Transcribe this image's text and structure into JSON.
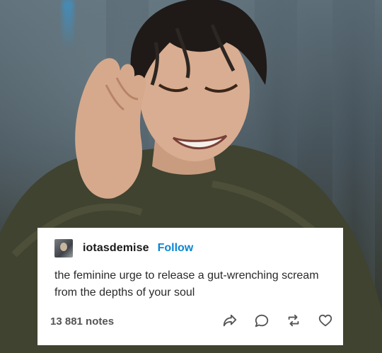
{
  "post": {
    "username": "iotasdemise",
    "follow_label": "Follow",
    "text": "the feminine urge to release a gut-wrenching scream from the depths of your soul",
    "notes": "13 881 notes"
  },
  "icons": {
    "share": "share-icon",
    "reply": "reply-icon",
    "reblog": "reblog-icon",
    "like": "heart-icon"
  },
  "colors": {
    "follow": "#0a86d6",
    "card_bg": "#ffffff",
    "text": "#2a2a2a",
    "muted": "#555555"
  }
}
